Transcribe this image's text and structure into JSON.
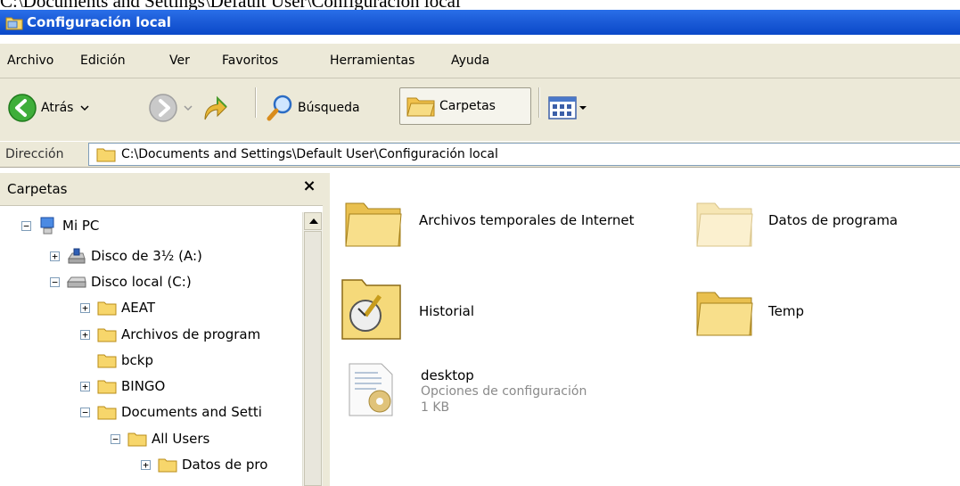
{
  "caption": "C:\\Documents and Settings\\Default User\\Configuración local",
  "window": {
    "title": "Configuración local"
  },
  "menu": [
    "Archivo",
    "Edición",
    "Ver",
    "Favoritos",
    "Herramientas",
    "Ayuda"
  ],
  "toolbar": {
    "back_label": "Atrás",
    "search_label": "Búsqueda",
    "folders_label": "Carpetas"
  },
  "address": {
    "label": "Dirección",
    "value": "C:\\Documents and Settings\\Default User\\Configuración local"
  },
  "folders_pane": {
    "title": "Carpetas",
    "close": "×",
    "tree": [
      {
        "label": "Mi PC",
        "expander": "−",
        "icon": "computer-icon"
      },
      {
        "label": "Disco de 3½ (A:)",
        "expander": "+",
        "icon": "floppy-drive-icon"
      },
      {
        "label": "Disco local (C:)",
        "expander": "−",
        "icon": "hard-disk-icon"
      },
      {
        "label": "AEAT",
        "expander": "+",
        "icon": "folder-icon"
      },
      {
        "label": "Archivos de program",
        "expander": "+",
        "icon": "folder-icon"
      },
      {
        "label": "bckp",
        "expander": "",
        "icon": "folder-icon"
      },
      {
        "label": "BINGO",
        "expander": "+",
        "icon": "folder-icon"
      },
      {
        "label": "Documents and Setti",
        "expander": "−",
        "icon": "folder-icon"
      },
      {
        "label": "All Users",
        "expander": "−",
        "icon": "folder-icon"
      },
      {
        "label": "Datos de pro",
        "expander": "+",
        "icon": "folder-icon"
      }
    ]
  },
  "items": [
    {
      "name": "Archivos temporales de Internet",
      "icon": "folder-icon"
    },
    {
      "name": "Datos de programa",
      "icon": "folder-faded-icon"
    },
    {
      "name": "Historial",
      "icon": "history-folder-icon"
    },
    {
      "name": "Temp",
      "icon": "folder-icon"
    },
    {
      "name": "desktop",
      "type": "Opciones de configuración",
      "size": "1 KB",
      "icon": "settings-file-icon"
    }
  ],
  "colors": {
    "titlebar": "#0a49c9",
    "chrome": "#ece9d8",
    "folder": "#f1d36b"
  }
}
